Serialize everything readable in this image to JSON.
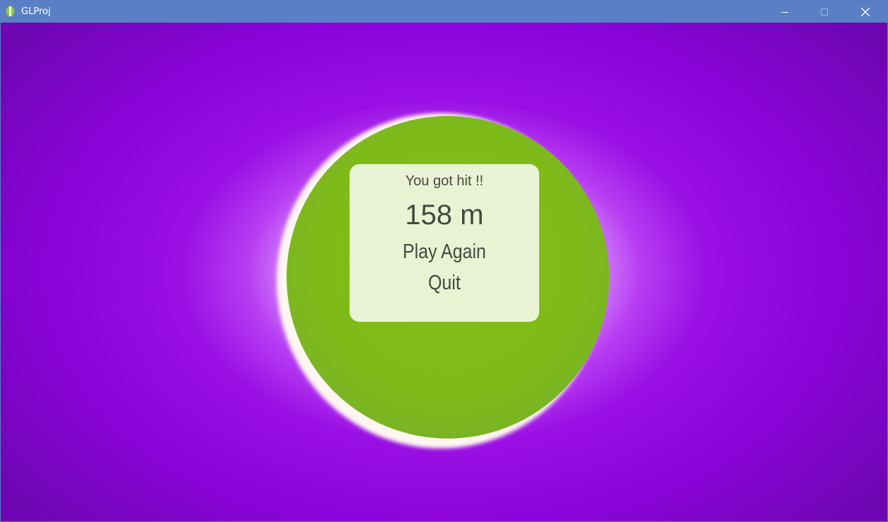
{
  "window": {
    "title": "GLProj",
    "icon": "app-icon"
  },
  "game_over_menu": {
    "message": "You got hit !!",
    "distance": "158 m",
    "play_again_label": "Play Again",
    "quit_label": "Quit"
  },
  "colors": {
    "titlebar": "#5b7fc4",
    "background": "#9a10e4",
    "ball": "#7fbf10",
    "panel": "#eaf2d4",
    "panel_text": "#424a3f"
  }
}
